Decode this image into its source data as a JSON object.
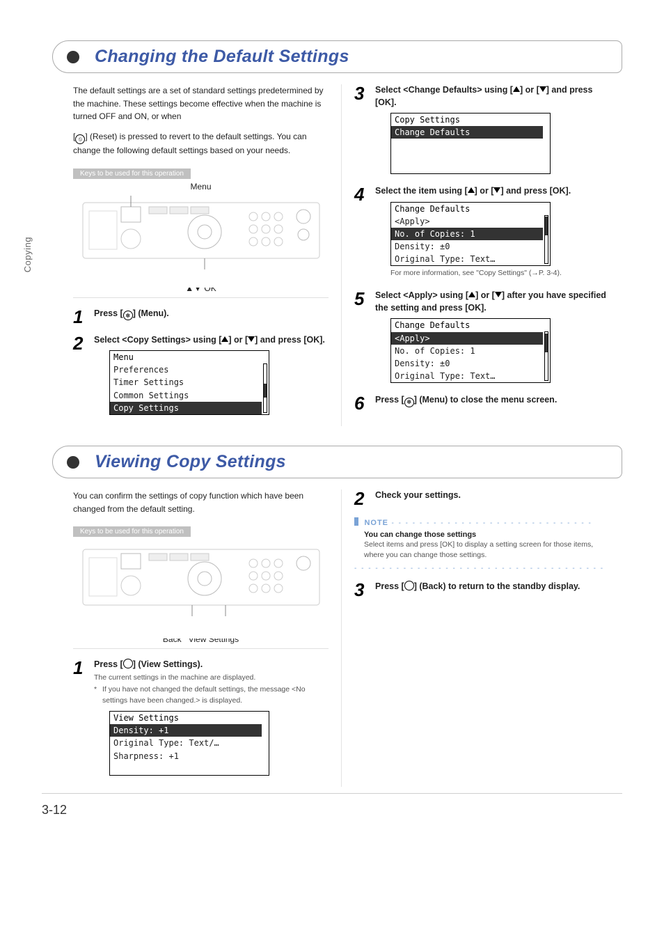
{
  "sideTab": "Copying",
  "pageNumber": "3-12",
  "sections": {
    "changing": {
      "title": "Changing the Default Settings",
      "intro1": "The default settings are a set of standard settings predetermined by the machine. These settings become effective when the machine is turned OFF and ON, or when",
      "intro2a": "[",
      "intro2b": "] (Reset) is pressed to revert to the default settings. You can change the following default settings based on your needs.",
      "keysStrip": "Keys to be used for this operation",
      "panelTopLabel": "Menu",
      "panelBottomLabel": "▲▼ OK",
      "steps": {
        "s1": {
          "num": "1",
          "head_a": "Press [",
          "head_b": "] (Menu)."
        },
        "s2": {
          "num": "2",
          "head_a": "Select <Copy Settings> using [",
          "head_b": "] or [",
          "head_c": "] and press [OK].",
          "lcd": {
            "title": "Menu",
            "lines": [
              " Preferences",
              " Timer Settings",
              " Common Settings"
            ],
            "inv": " Copy Settings"
          }
        },
        "s3": {
          "num": "3",
          "head_a": "Select <Change Defaults> using [",
          "head_b": "] or [",
          "head_c": "] and press [OK].",
          "lcd": {
            "title": "Copy Settings",
            "inv": " Change Defaults"
          }
        },
        "s4": {
          "num": "4",
          "head_a": "Select the item using [",
          "head_b": "] or [",
          "head_c": "] and press [OK].",
          "lcd": {
            "title": "Change Defaults",
            "lines": [
              " <Apply>"
            ],
            "inv": " No. of Copies: 1",
            "after": [
              " Density: ±0",
              " Original Type: Text…"
            ]
          },
          "crossRef": "For more information, see \"Copy Settings\" (→P. 3-4)."
        },
        "s5": {
          "num": "5",
          "head_a": "Select <Apply> using [",
          "head_b": "] or [",
          "head_c": "] after you have specified the setting and press [OK].",
          "lcd": {
            "title": "Change Defaults",
            "inv": " <Apply>",
            "after": [
              " No. of Copies: 1",
              " Density: ±0",
              " Original Type: Text…"
            ]
          }
        },
        "s6": {
          "num": "6",
          "head_a": "Press [",
          "head_b": "] (Menu) to close the menu screen."
        }
      }
    },
    "viewing": {
      "title": "Viewing Copy Settings",
      "intro": "You can confirm the settings of copy function which have been changed from the default setting.",
      "keysStrip": "Keys to be used for this operation",
      "panelBottomLeft": "Back",
      "panelBottomRight": "View Settings",
      "steps": {
        "s1": {
          "num": "1",
          "head_a": "Press [",
          "head_b": "] (View Settings).",
          "sub1": "The current settings in the machine are displayed.",
          "sub2": "If you have not changed the default settings, the message <No settings have been changed.> is displayed.",
          "lcd": {
            "title": "View Settings",
            "inv": " Density: +1",
            "after": [
              " Original Type: Text/…",
              " Sharpness: +1"
            ]
          }
        },
        "s2": {
          "num": "2",
          "head": "Check your settings.",
          "noteWord": "NOTE",
          "noteTitle": "You can change those settings",
          "noteBody": "Select items and press [OK] to display a setting screen for those items, where you can change those settings."
        },
        "s3": {
          "num": "3",
          "head_a": "Press [",
          "head_b": "] (Back) to return to the standby display."
        }
      }
    }
  }
}
